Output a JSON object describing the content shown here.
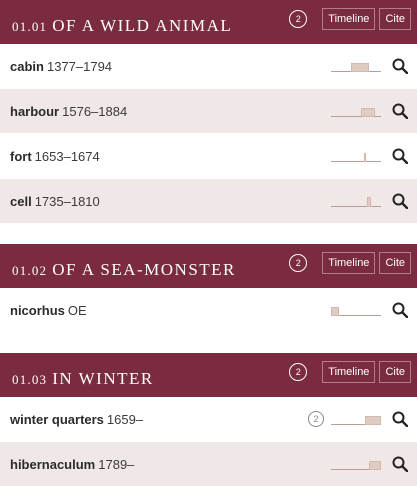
{
  "sections": [
    {
      "number": "01.01",
      "title": "OF A WILD ANIMAL",
      "badge": "2",
      "timeline_label": "Timeline",
      "cite_label": "Cite",
      "rows": [
        {
          "word": "cabin",
          "dates": "1377–1794",
          "shade": false
        },
        {
          "word": "harbour",
          "dates": "1576–1884",
          "shade": true
        },
        {
          "word": "fort",
          "dates": "1653–1674",
          "shade": false
        },
        {
          "word": "cell",
          "dates": "1735–1810",
          "shade": true
        }
      ]
    },
    {
      "number": "01.02",
      "title": "OF A SEA-MONSTER",
      "badge": "2",
      "timeline_label": "Timeline",
      "cite_label": "Cite",
      "rows": [
        {
          "word": "nicorhus",
          "dates": "OE",
          "shade": false
        }
      ]
    },
    {
      "number": "01.03",
      "title": "IN WINTER",
      "badge": "2",
      "timeline_label": "Timeline",
      "cite_label": "Cite",
      "rows": [
        {
          "word": "winter quarters",
          "dates": "1659–",
          "shade": false,
          "badge": "2"
        },
        {
          "word": "hibernaculum",
          "dates": "1789–",
          "shade": true
        }
      ]
    }
  ],
  "icons": {
    "search": "search-icon",
    "badge": "quotation-count-badge"
  },
  "colors": {
    "header_bg": "#7a2b3f",
    "row_shade": "#efe8e6",
    "spark_bar": "#e0cbc3"
  }
}
